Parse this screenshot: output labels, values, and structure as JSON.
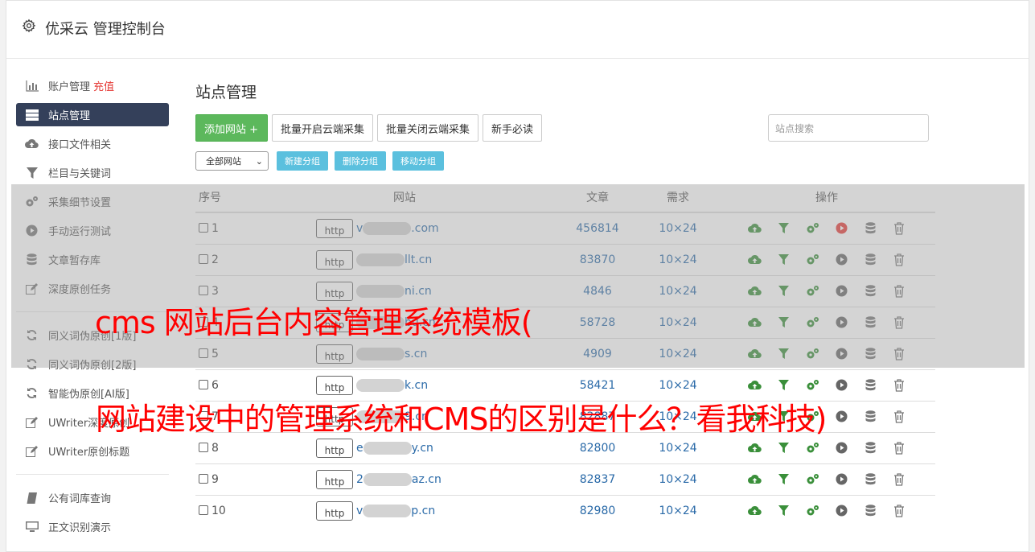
{
  "app": {
    "title": "优采云 管理控制台"
  },
  "sidebar": {
    "items": [
      {
        "label": "账户管理",
        "extra": "充值",
        "icon": "bar-chart-icon"
      },
      {
        "label": "站点管理",
        "icon": "server-icon",
        "active": true
      },
      {
        "label": "接口文件相关",
        "icon": "cloud-upload-icon"
      },
      {
        "label": "栏目与关键词",
        "icon": "filter-icon"
      },
      {
        "label": "采集细节设置",
        "icon": "cogs-icon"
      },
      {
        "label": "手动运行测试",
        "icon": "play-circle-icon"
      },
      {
        "label": "文章暂存库",
        "icon": "database-icon"
      },
      {
        "label": "深度原创任务",
        "icon": "edit-icon"
      }
    ],
    "items2": [
      {
        "label": "同义词伪原创[1版]",
        "icon": "refresh-icon"
      },
      {
        "label": "同义词伪原创[2版]",
        "icon": "refresh-icon"
      },
      {
        "label": "智能伪原创[AI版]",
        "icon": "refresh-icon"
      },
      {
        "label": "UWriter深度原创",
        "icon": "edit-icon"
      },
      {
        "label": "UWriter原创标题",
        "icon": "edit-icon"
      }
    ],
    "items3": [
      {
        "label": "公有词库查询",
        "icon": "book-icon"
      },
      {
        "label": "正文识别演示",
        "icon": "monitor-icon"
      }
    ]
  },
  "main": {
    "title": "站点管理",
    "buttons": {
      "add": "添加网站 +",
      "batch_open": "批量开启云端采集",
      "batch_close": "批量关闭云端采集",
      "guide": "新手必读"
    },
    "search_placeholder": "站点搜索",
    "filter": {
      "selected": "全部网站",
      "arrow": "⌄"
    },
    "group_buttons": {
      "new": "新建分组",
      "delete": "删除分组",
      "move": "移动分组"
    },
    "table": {
      "headers": [
        "序号",
        "网站",
        "文章",
        "需求",
        "操作"
      ],
      "rows": [
        {
          "no": "1",
          "scheme": "http",
          "domain_prefix": "v",
          "domain": ".com",
          "articles": "456814",
          "demand": "10×24",
          "play_red": true
        },
        {
          "no": "2",
          "scheme": "http",
          "domain_prefix": "",
          "domain": "llt.cn",
          "articles": "83870",
          "demand": "10×24",
          "play_red": false
        },
        {
          "no": "3",
          "scheme": "http",
          "domain_prefix": "",
          "domain": "ni.cn",
          "articles": "4846",
          "demand": "10×24",
          "play_red": false
        },
        {
          "no": "4",
          "scheme": "http",
          "domain_prefix": "",
          "domain": "bu.cn",
          "articles": "58728",
          "demand": "10×24",
          "play_red": false
        },
        {
          "no": "5",
          "scheme": "http",
          "domain_prefix": "",
          "domain": "s.cn",
          "articles": "4909",
          "demand": "10×24",
          "play_red": false
        },
        {
          "no": "6",
          "scheme": "http",
          "domain_prefix": "",
          "domain": "k.cn",
          "articles": "58421",
          "demand": "10×24",
          "play_red": false
        },
        {
          "no": "7",
          "scheme": "http",
          "domain_prefix": "",
          "domain": "9.cn",
          "articles": "82887",
          "demand": "10×24",
          "play_red": false
        },
        {
          "no": "8",
          "scheme": "http",
          "domain_prefix": "e",
          "domain": "y.cn",
          "articles": "82800",
          "demand": "10×24",
          "play_red": false
        },
        {
          "no": "9",
          "scheme": "http",
          "domain_prefix": "2",
          "domain": "az.cn",
          "articles": "82837",
          "demand": "10×24",
          "play_red": false
        },
        {
          "no": "10",
          "scheme": "http",
          "domain_prefix": "v",
          "domain": "p.cn",
          "articles": "82980",
          "demand": "10×24",
          "play_red": false
        }
      ]
    }
  },
  "overlay": {
    "line1": "cms 网站后台内容管理系统模板(",
    "line2": "网站建设中的管理系统和CMS的区别是什么？看我科技)"
  },
  "colors": {
    "accent_green": "#5cb85c",
    "info_blue": "#5bc0de",
    "sidebar_active": "#34405a",
    "link_blue": "#2a6aa8",
    "overlay_red": "#ff0000"
  }
}
